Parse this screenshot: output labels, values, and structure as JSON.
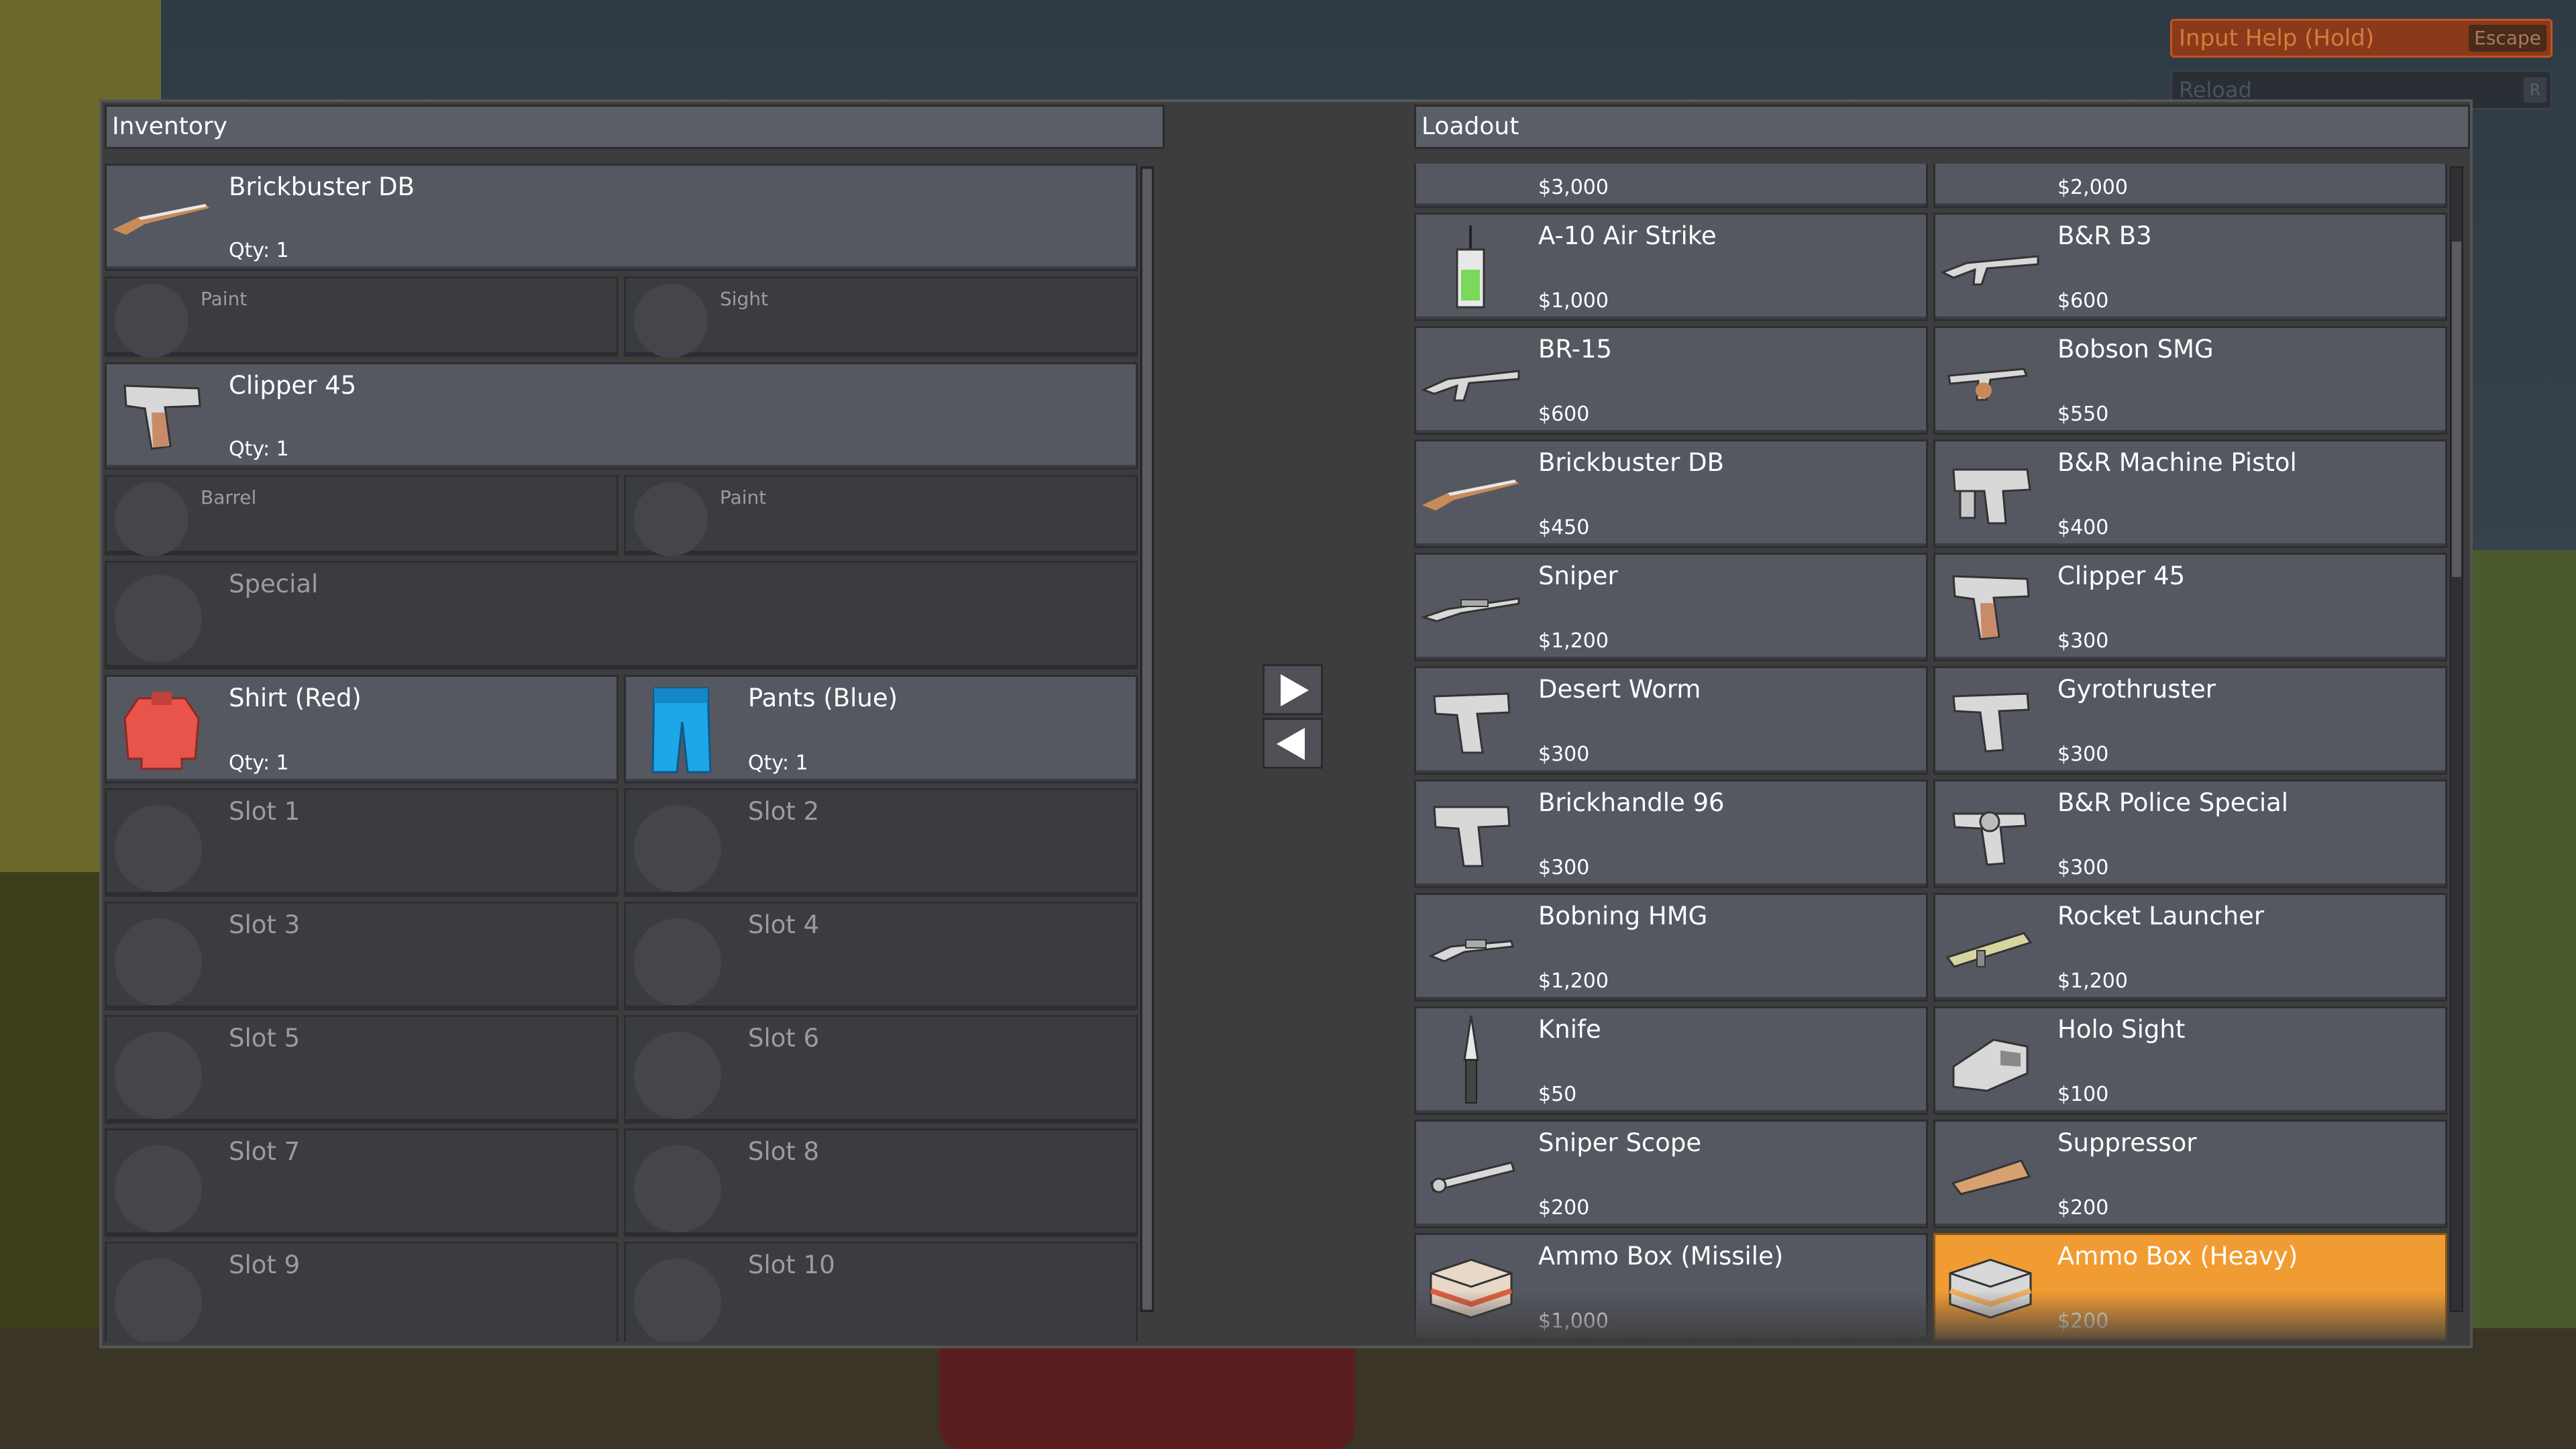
{
  "hud": {
    "input_help": "Input Help (Hold)",
    "input_help_key": "Escape",
    "reload": "Reload",
    "reload_key": "R"
  },
  "inventory": {
    "title": "Inventory",
    "items": [
      {
        "name": "Brickbuster DB",
        "qty": "Qty: 1",
        "icon": "shotgun-icon"
      },
      {
        "name": "Clipper 45",
        "qty": "Qty: 1",
        "icon": "pistol-icon"
      }
    ],
    "attachments_1": [
      {
        "label": "Paint"
      },
      {
        "label": "Sight"
      }
    ],
    "attachments_2": [
      {
        "label": "Barrel"
      },
      {
        "label": "Paint"
      }
    ],
    "special": "Special",
    "clothing": [
      {
        "name": "Shirt (Red)",
        "qty": "Qty: 1",
        "color": "#e8544a"
      },
      {
        "name": "Pants (Blue)",
        "qty": "Qty: 1",
        "color": "#1da6e8"
      }
    ],
    "slots": [
      "Slot 1",
      "Slot 2",
      "Slot 3",
      "Slot 4",
      "Slot 5",
      "Slot 6",
      "Slot 7",
      "Slot 8",
      "Slot 9",
      "Slot 10"
    ]
  },
  "transfer": {
    "right_icon": "arrow-right-icon",
    "left_icon": "arrow-left-icon"
  },
  "loadout": {
    "title": "Loadout",
    "top_partial": [
      {
        "price": "$3,000"
      },
      {
        "price": "$2,000"
      }
    ],
    "items": [
      {
        "name": "A-10 Air Strike",
        "price": "$1,000",
        "icon": "radio-icon"
      },
      {
        "name": "B&R B3",
        "price": "$600",
        "icon": "rifle-icon"
      },
      {
        "name": "BR-15",
        "price": "$600",
        "icon": "rifle-icon"
      },
      {
        "name": "Bobson SMG",
        "price": "$550",
        "icon": "smg-icon"
      },
      {
        "name": "Brickbuster DB",
        "price": "$450",
        "icon": "shotgun-icon"
      },
      {
        "name": "B&R Machine Pistol",
        "price": "$400",
        "icon": "machine-pistol-icon"
      },
      {
        "name": "Sniper",
        "price": "$1,200",
        "icon": "sniper-icon"
      },
      {
        "name": "Clipper 45",
        "price": "$300",
        "icon": "pistol-icon"
      },
      {
        "name": "Desert Worm",
        "price": "$300",
        "icon": "pistol-icon"
      },
      {
        "name": "Gyrothruster",
        "price": "$300",
        "icon": "pistol-icon"
      },
      {
        "name": "Brickhandle 96",
        "price": "$300",
        "icon": "pistol-icon"
      },
      {
        "name": "B&R Police Special",
        "price": "$300",
        "icon": "revolver-icon"
      },
      {
        "name": "Bobning HMG",
        "price": "$1,200",
        "icon": "hmg-icon"
      },
      {
        "name": "Rocket Launcher",
        "price": "$1,200",
        "icon": "rocket-launcher-icon"
      },
      {
        "name": "Knife",
        "price": "$50",
        "icon": "knife-icon"
      },
      {
        "name": "Holo Sight",
        "price": "$100",
        "icon": "holo-sight-icon"
      },
      {
        "name": "Sniper Scope",
        "price": "$200",
        "icon": "scope-icon"
      },
      {
        "name": "Suppressor",
        "price": "$200",
        "icon": "suppressor-icon"
      },
      {
        "name": "Ammo Box (Missile)",
        "price": "$1,000",
        "icon": "ammo-box-icon"
      },
      {
        "name": "Ammo Box (Heavy)",
        "price": "$200",
        "icon": "ammo-box-icon",
        "selected": true
      }
    ]
  },
  "colors": {
    "selected": "#f19c32",
    "panel": "#3d3d3d",
    "item": "#555861"
  }
}
